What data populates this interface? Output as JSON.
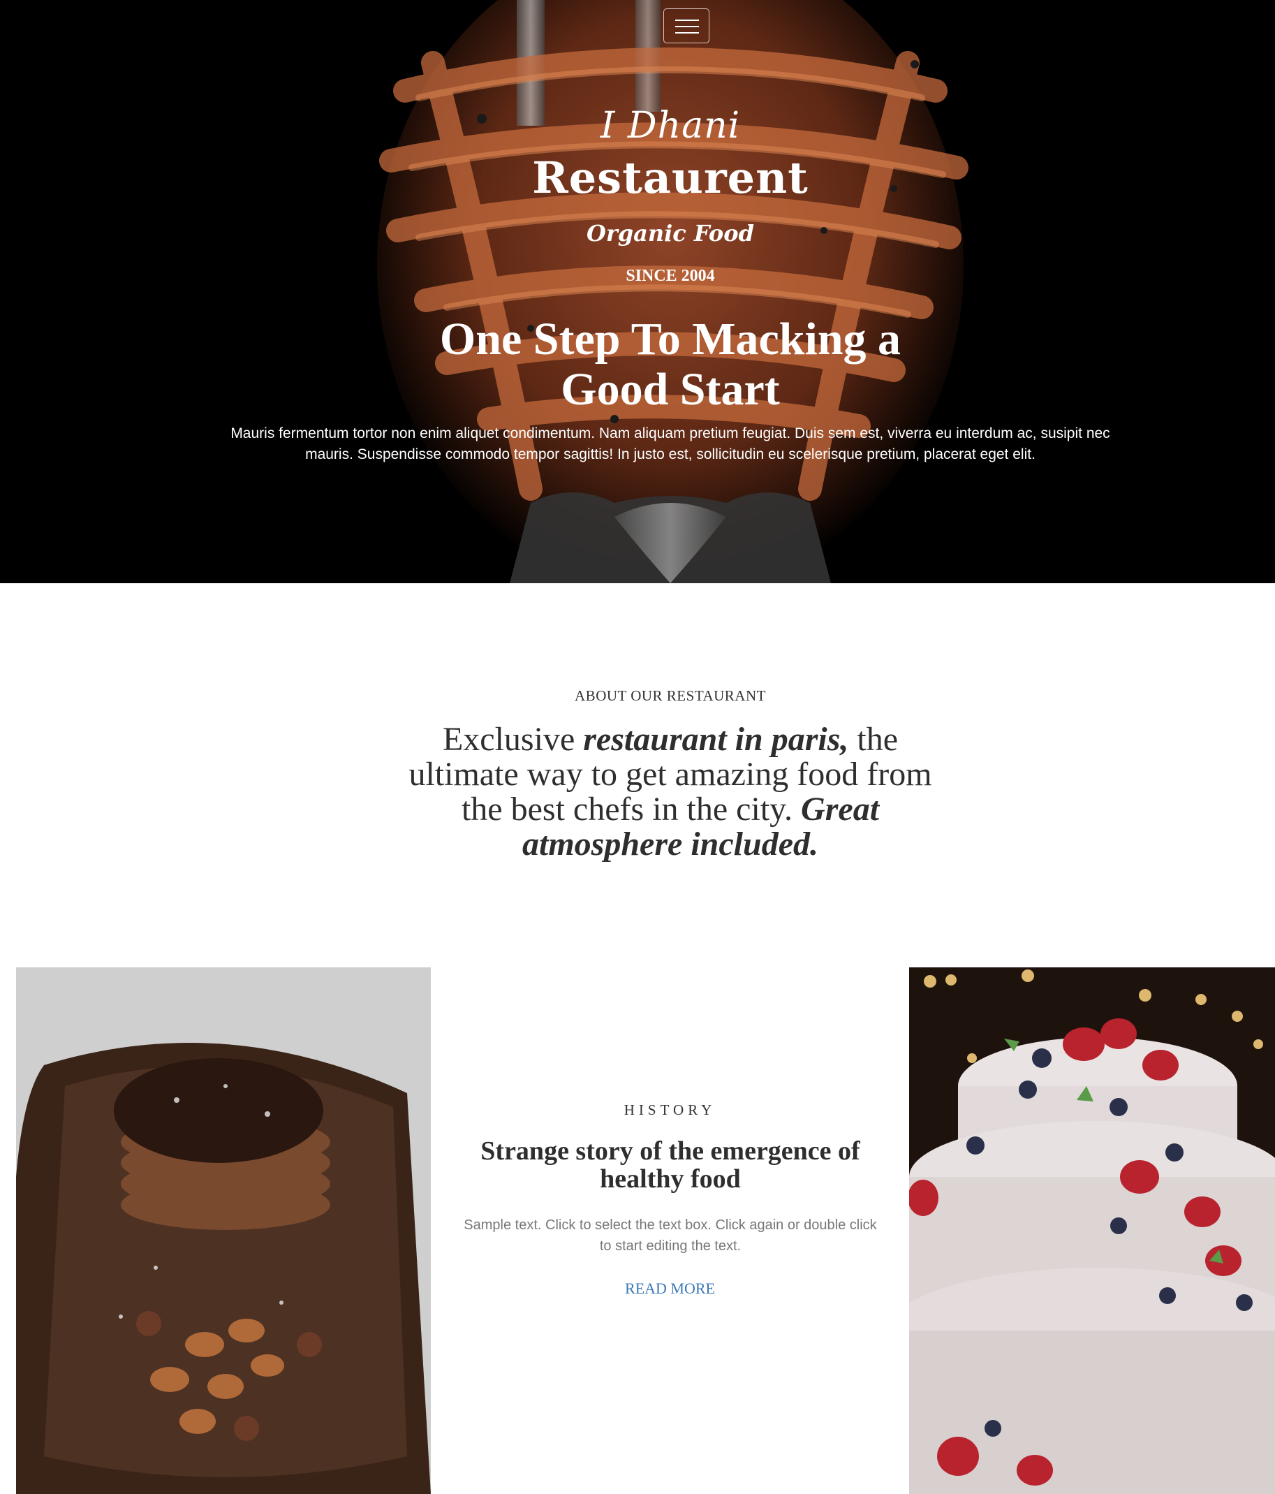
{
  "nav": {
    "menu_icon": "hamburger-menu-icon"
  },
  "hero": {
    "brand_top": "I Dhani",
    "brand_main": "Restaurent",
    "brand_sub": "Organic Food",
    "since": "SINCE 2004",
    "heading": "One Step To Macking a Good Start",
    "text": "Mauris fermentum tortor non enim aliquet condimentum. Nam aliquam pretium feugiat. Duis sem est, viverra eu interdum ac, susipit nec mauris. Suspendisse commodo tempor sagittis! In justo est, sollicitudin eu scelerisque pretium, placerat eget elit."
  },
  "about": {
    "eyebrow": "ABOUT OUR RESTAURANT",
    "text_1": "Exclusive ",
    "text_2": "restaurant in paris,",
    "text_3": " the ultimate way to get amazing food from the best chefs in the city. ",
    "text_4": "Great atmosphere included."
  },
  "history": {
    "eyebrow": "HISTORY",
    "title": "Strange story of the emergence of healthy food",
    "text": "Sample text. Click to select the text box. Click again or double click to start editing the text.",
    "read_more": "READ MORE"
  },
  "colors": {
    "hero_bg": "#000000",
    "heading_text": "#2e2e2e",
    "body_text": "#777777",
    "link": "#3a78b8"
  }
}
